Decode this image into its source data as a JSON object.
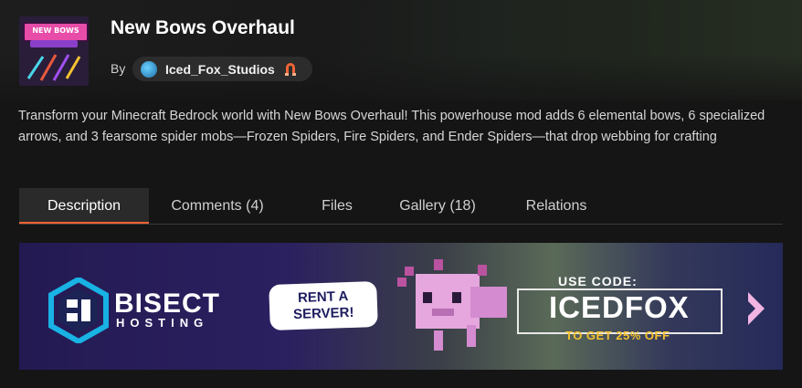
{
  "project": {
    "title": "New Bows Overhaul",
    "by_label": "By",
    "author": "Iced_Fox_Studios",
    "thumbnail_text": "NEW BOWS",
    "description": "Transform your Minecraft Bedrock world with New Bows Overhaul! This powerhouse mod adds 6 elemental bows, 6 specialized arrows, and 3 fearsome spider mobs—Frozen Spiders, Fire Spiders, and Ender Spiders—that drop webbing for crafting"
  },
  "tabs": [
    {
      "label": "Description",
      "active": true
    },
    {
      "label": "Comments (4)",
      "active": false
    },
    {
      "label": "Files",
      "active": false
    },
    {
      "label": "Gallery (18)",
      "active": false
    },
    {
      "label": "Relations",
      "active": false
    }
  ],
  "banner": {
    "brand_top": "BISECT",
    "brand_bottom": "HOSTING",
    "bubble": "RENT A SERVER!",
    "use_code": "USE CODE:",
    "code": "ICEDFOX",
    "discount": "TO GET 25% OFF"
  },
  "colors": {
    "accent": "#f16436",
    "banner_discount": "#f6c230",
    "background": "#151515"
  },
  "icons": [
    "author-avatar",
    "premium-author-badge-icon",
    "banner-next-arrow-icon"
  ]
}
